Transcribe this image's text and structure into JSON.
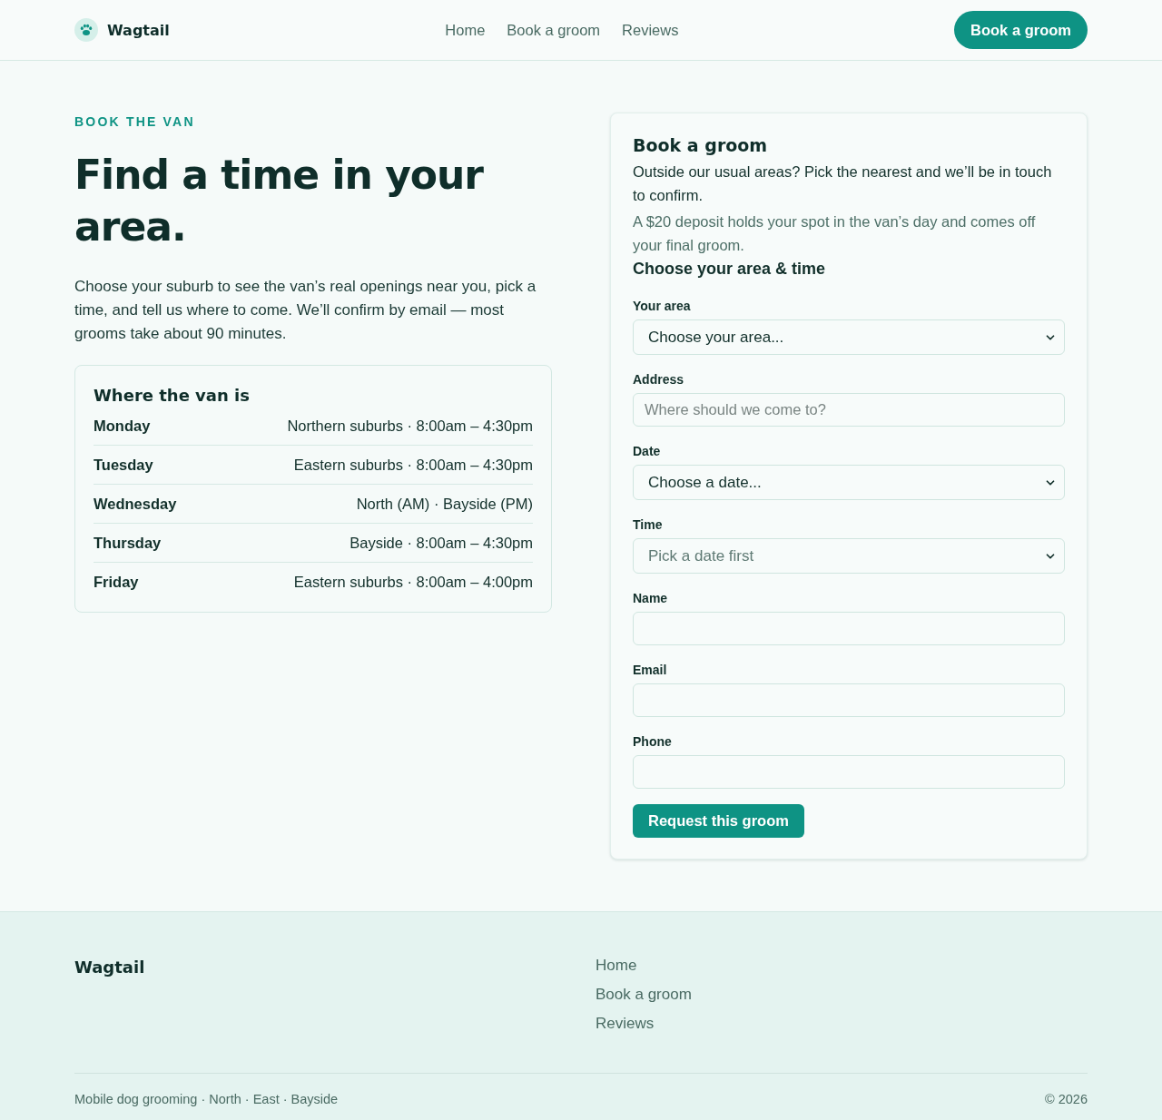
{
  "header": {
    "brand": "Wagtail",
    "nav": [
      "Home",
      "Book a groom",
      "Reviews"
    ],
    "cta": "Book a groom"
  },
  "intro": {
    "eyebrow": "BOOK THE VAN",
    "title": "Find a time in your area.",
    "body": "Choose your suburb to see the van’s real openings near you, pick a time, and tell us where to come. We’ll confirm by email — most grooms take about 90 minutes."
  },
  "schedule": {
    "title": "Where the van is",
    "rows": [
      {
        "day": "Monday",
        "detail": "Northern suburbs · 8:00am – 4:30pm"
      },
      {
        "day": "Tuesday",
        "detail": "Eastern suburbs · 8:00am – 4:30pm"
      },
      {
        "day": "Wednesday",
        "detail": "North (AM) · Bayside (PM)"
      },
      {
        "day": "Thursday",
        "detail": "Bayside · 8:00am – 4:30pm"
      },
      {
        "day": "Friday",
        "detail": "Eastern suburbs · 8:00am – 4:00pm"
      }
    ]
  },
  "booking": {
    "title": "Book a groom",
    "intro": "Outside our usual areas? Pick the nearest and we’ll be in touch to confirm.",
    "note": "A $20 deposit holds your spot in the van’s day and comes off your final groom.",
    "section_title": "Choose your area & time",
    "fields": [
      {
        "kind": "select",
        "label": "Your area",
        "value": "Choose your area...",
        "disabled": false
      },
      {
        "kind": "text",
        "label": "Address",
        "placeholder": "Where should we come to?",
        "disabled": false
      },
      {
        "kind": "select",
        "label": "Date",
        "value": "Choose a date...",
        "disabled": false
      },
      {
        "kind": "select",
        "label": "Time",
        "value": "Pick a date first",
        "disabled": true
      },
      {
        "kind": "text",
        "label": "Name",
        "disabled": false
      },
      {
        "kind": "text",
        "label": "Email",
        "disabled": false
      },
      {
        "kind": "text",
        "label": "Phone",
        "disabled": false
      }
    ],
    "submit": "Request this groom"
  },
  "footer": {
    "brand": "Wagtail",
    "links": [
      "Home",
      "Book a groom",
      "Reviews"
    ],
    "tagline": "Mobile dog grooming · North · East · Bayside",
    "copyright": "© 2026"
  }
}
